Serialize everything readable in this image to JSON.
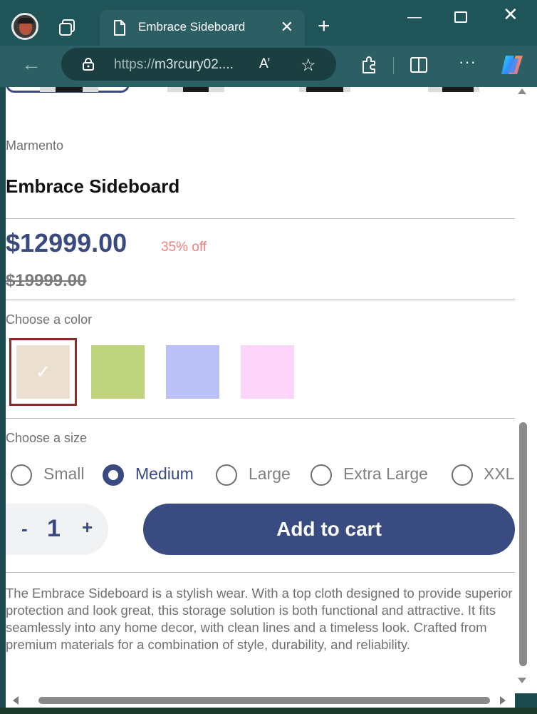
{
  "browser": {
    "tab_title": "Embrace Sideboard",
    "url_protocol": "https://",
    "url_host": "m3rcury02....",
    "read_aloud_label": "A’",
    "icons": [
      "avatar",
      "tabs-icon",
      "document-icon",
      "close-icon",
      "plus-icon",
      "minimize-icon",
      "maximize-icon",
      "back-arrow-icon",
      "lock-icon",
      "read-aloud-icon",
      "star-icon",
      "extensions-icon",
      "split-screen-icon",
      "more-icon",
      "copilot-icon"
    ]
  },
  "product": {
    "brand": "Marmento",
    "title": "Embrace Sideboard",
    "price": "$12999.00",
    "discount": "35% off",
    "old_price": "$19999.00",
    "color_label": "Choose a color",
    "colors": [
      {
        "hex": "#ebdfd0",
        "selected": true,
        "check": "✓"
      },
      {
        "hex": "#bed37c",
        "selected": false,
        "check": ""
      },
      {
        "hex": "#bcc1f5",
        "selected": false,
        "check": ""
      },
      {
        "hex": "#fdd4fa",
        "selected": false,
        "check": ""
      }
    ],
    "size_label": "Choose a size",
    "sizes": [
      {
        "label": "Small",
        "selected": false
      },
      {
        "label": "Medium",
        "selected": true
      },
      {
        "label": "Large",
        "selected": false
      },
      {
        "label": "Extra Large",
        "selected": false
      },
      {
        "label": "XXL",
        "selected": false
      }
    ],
    "quantity": {
      "minus": "-",
      "value": "1",
      "plus": "+"
    },
    "add_to_cart": "Add to cart",
    "description": "The Embrace Sideboard is a stylish wear. With a top cloth designed to provide superior protection and look great, this storage solution is both functional and attractive. It fits seamlessly into any home decor, with clean lines and a timeless look. Crafted from premium materials for a combination of style, durability, and reliability."
  },
  "theme": {
    "accent": "#384a80",
    "discount": "#f08080",
    "selected_border": "#8b2a2a"
  }
}
